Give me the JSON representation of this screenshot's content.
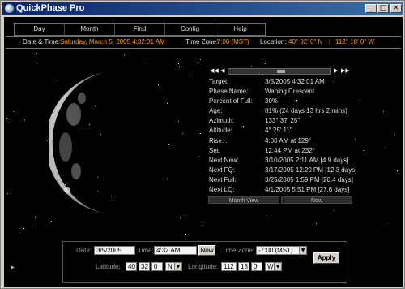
{
  "window": {
    "title": "QuickPhase Pro"
  },
  "menu": {
    "items": [
      "Day",
      "Month",
      "Find",
      "Config",
      "Help"
    ]
  },
  "infobar": {
    "date_label": "Date & Time:",
    "date_value": "Saturday, March 5, 2005  4:32:01 AM",
    "tz_label": "Time Zone:",
    "tz_value": "-7:00 (MST)",
    "loc_label": "Location:",
    "lat_value": "40° 32' 0\" N",
    "separator": "|",
    "lon_value": "112° 18' 0\" W"
  },
  "info": {
    "rows": [
      {
        "label": "Target:",
        "value": "3/5/2005 4:32:01 AM"
      },
      {
        "label": "Phase Name:",
        "value": "Waning Crescent"
      },
      {
        "label": "Percent of Full:",
        "value": "30%"
      },
      {
        "label": "Age:",
        "value": "81% (24 days 13 hrs 2 mins)"
      },
      {
        "label": "Azimuth:",
        "value": "133° 37' 25\""
      },
      {
        "label": "Altitude:",
        "value": "4° 25' 11\""
      },
      {
        "label": "Rise:",
        "value": "4:00 AM at 129°"
      },
      {
        "label": "Set:",
        "value": "12:44 PM at 232°"
      },
      {
        "label": "Next New:",
        "value": "3/10/2005 2:11 AM  [4.9 days]"
      },
      {
        "label": "Next FQ:",
        "value": "3/17/2005 12:20 PM  [12.3 days]"
      },
      {
        "label": "Next Full:",
        "value": "3/25/2005 1:59 PM  [20.4 days]"
      },
      {
        "label": "Next LQ:",
        "value": "4/1/2005 5:51 PM  [27.6 days]"
      }
    ],
    "month_view": "Month View",
    "now": "Now"
  },
  "controls": {
    "date_label": "Date:",
    "date_value": "3/5/2005",
    "time_label": "Time:",
    "time_value": "4:32 AM",
    "now_button": "Now",
    "tz_label": "Time Zone:",
    "tz_value": "-7:00 (MST)",
    "lat_label": "Latitude:",
    "lat_deg": "40",
    "lat_min": "32",
    "lat_sec": "0",
    "lat_hemi": "N",
    "lon_label": "Longitude:",
    "lon_deg": "112",
    "lon_min": "18",
    "lon_sec": "0",
    "lon_hemi": "W",
    "apply": "Apply"
  },
  "icons": {
    "app": "moon-app-icon",
    "minimize": "minimize-icon",
    "maximize": "maximize-icon",
    "close": "close-icon"
  },
  "colors": {
    "accent": "#ff9a00",
    "titlebar": "#0a246a"
  }
}
